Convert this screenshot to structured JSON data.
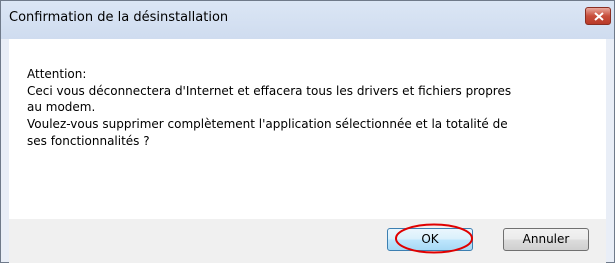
{
  "window": {
    "title": "Confirmation de la désinstallation",
    "close_icon": "close-icon"
  },
  "message": {
    "lines": [
      "Attention:",
      "Ceci vous déconnectera d'Internet et effacera tous les drivers et fichiers propres",
      "au modem.",
      "Voulez-vous supprimer complètement l'application sélectionnée et la totalité de",
      "ses fonctionnalités ?"
    ]
  },
  "buttons": {
    "ok": "OK",
    "cancel": "Annuler"
  },
  "colors": {
    "annotation": "#e00000",
    "default_button_border": "#3c7fb1"
  }
}
